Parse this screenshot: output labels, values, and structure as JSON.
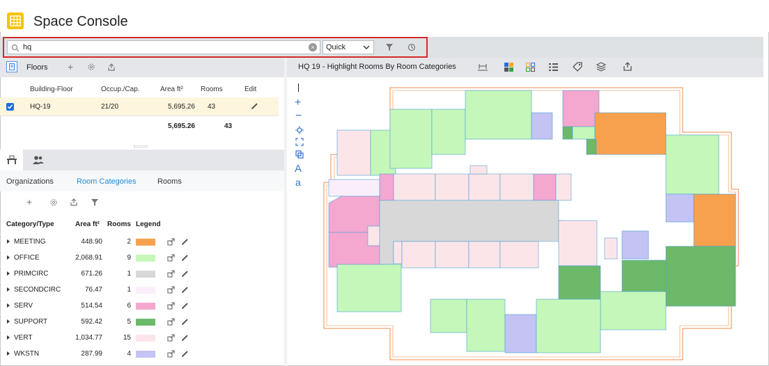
{
  "app": {
    "title": "Space Console"
  },
  "search": {
    "value": "hq",
    "mode": "Quick"
  },
  "floors_panel": {
    "title": "Floors"
  },
  "floors_table": {
    "headers": [
      "Building-Floor",
      "Occup./Cap.",
      "Area ft²",
      "Rooms",
      "Edit"
    ],
    "rows": [
      {
        "floor": "HQ-19",
        "occupancy": "21/20",
        "area": "5,695.26",
        "rooms": "43"
      }
    ],
    "totals": {
      "area": "5,695.26",
      "rooms": "43"
    }
  },
  "category_tabs": {
    "tabs": [
      "Organizations",
      "Room Categories",
      "Rooms"
    ],
    "active": "Room Categories"
  },
  "category_table": {
    "headers": [
      "Category/Type",
      "Area ft²",
      "Rooms",
      "Legend"
    ],
    "rows": [
      {
        "name": "MEETING",
        "area": "448.90",
        "rooms": "2",
        "color": "#f7a14f"
      },
      {
        "name": "OFFICE",
        "area": "2,068.91",
        "rooms": "9",
        "color": "#c4f7b9"
      },
      {
        "name": "PRIMCIRC",
        "area": "671.26",
        "rooms": "1",
        "color": "#d8d8d8"
      },
      {
        "name": "SECONDCIRC",
        "area": "76.47",
        "rooms": "1",
        "color": "#fbeefb"
      },
      {
        "name": "SERV",
        "area": "514.54",
        "rooms": "6",
        "color": "#f4a7cf"
      },
      {
        "name": "SUPPORT",
        "area": "592.42",
        "rooms": "5",
        "color": "#6db96a"
      },
      {
        "name": "VERT",
        "area": "1,034.77",
        "rooms": "15",
        "color": "#fce5e9"
      },
      {
        "name": "WKSTN",
        "area": "287.99",
        "rooms": "4",
        "color": "#c4c3f4"
      }
    ]
  },
  "map_panel": {
    "title": "HQ 19 - Highlight Rooms By Room Categories"
  },
  "map_tools": [
    "A",
    "a"
  ]
}
